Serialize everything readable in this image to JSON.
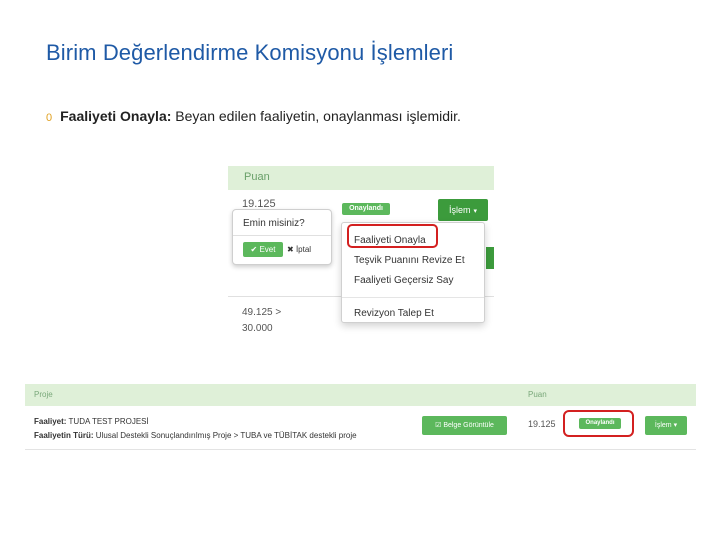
{
  "slide": {
    "title": "Birim Değerlendirme Komisyonu İşlemleri",
    "bullet_marker": "0",
    "bullet_bold": "Faaliyeti Onayla:",
    "bullet_text": " Beyan edilen faaliyetin, onaylanması işlemidir."
  },
  "screenshot1": {
    "header_puan": "Puan",
    "value_top": "19.125",
    "badge": "Onaylandı",
    "islem_button": "İşlem",
    "caret": "▾",
    "popover": {
      "question": "Emin misiniz?",
      "yes_icon": "✔",
      "yes": "Evet",
      "cancel_icon": "✖",
      "cancel": "İptal"
    },
    "dropdown_items": [
      "Faaliyeti Onayla",
      "Teşvik Puanını Revize Et",
      "Faaliyeti Geçersiz Say",
      "Revizyon Talep Et"
    ],
    "value_bottom_1": "49.125 >",
    "value_bottom_2": "30.000"
  },
  "screenshot2": {
    "header_proje": "Proje",
    "header_puan": "Puan",
    "faaliyet_label": "Faaliyet:",
    "faaliyet_value": " TUDA TEST PROJESİ",
    "turu_label": "Faaliyetin Türü:",
    "turu_value": " Ulusal Destekli Sonuçlandırılmış Proje > TUBA ve TÜBİTAK destekli proje",
    "belge_icon": "☑",
    "belge_button": "Belge Görüntüle",
    "puan_value": "19.125",
    "badge": "Onaylandı",
    "islem_button": "İşlem",
    "caret": "▾"
  },
  "colors": {
    "title_blue": "#1f5aa6",
    "header_green_bg": "#dff0d8",
    "button_green": "#5cb85c",
    "highlight_red": "#d32020"
  }
}
